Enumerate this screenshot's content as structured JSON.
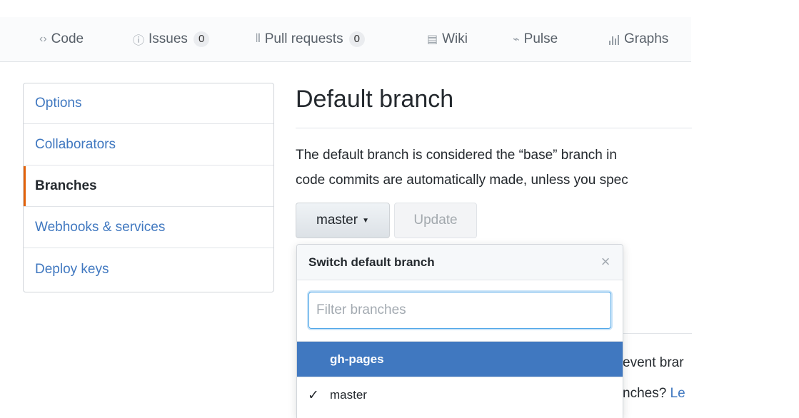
{
  "tabnav": {
    "tabs": [
      {
        "icon": "code-icon",
        "glyph": "‹›",
        "label": "Code"
      },
      {
        "icon": "issue-icon",
        "glyph": "ⓘ",
        "label": "Issues",
        "count": "0"
      },
      {
        "icon": "pull-request-icon",
        "glyph": "⫴",
        "label": "Pull requests",
        "count": "0"
      },
      {
        "icon": "wiki-icon",
        "glyph": "▤",
        "label": "Wiki"
      },
      {
        "icon": "pulse-icon",
        "glyph": "⌁",
        "label": "Pulse"
      },
      {
        "icon": "graph-icon",
        "glyph": "📊",
        "label": "Graphs"
      }
    ]
  },
  "sidebar": {
    "items": [
      {
        "label": "Options"
      },
      {
        "label": "Collaborators"
      },
      {
        "label": "Branches",
        "selected": true
      },
      {
        "label": "Webhooks & services"
      },
      {
        "label": "Deploy keys"
      }
    ]
  },
  "main": {
    "title": "Default branch",
    "description_line1": "The default branch is considered the “base” branch in",
    "description_line2": "code commits are automatically made, unless you spec",
    "branch_button": "master",
    "update_button": "Update",
    "behind_line1": "event brar",
    "behind_line2_text": "nches? ",
    "behind_line2_link": "Le"
  },
  "dropdown": {
    "title": "Switch default branch",
    "close_glyph": "×",
    "filter_placeholder": "Filter branches",
    "filter_value": "",
    "branches": [
      {
        "name": "gh-pages",
        "active": true,
        "checked": false
      },
      {
        "name": "master",
        "active": false,
        "checked": true
      }
    ],
    "check_glyph": "✓"
  },
  "colors": {
    "link": "#4078c0",
    "selected_marker": "#e36209",
    "active_row": "#4078c0",
    "focus_border": "#51a7e8"
  }
}
